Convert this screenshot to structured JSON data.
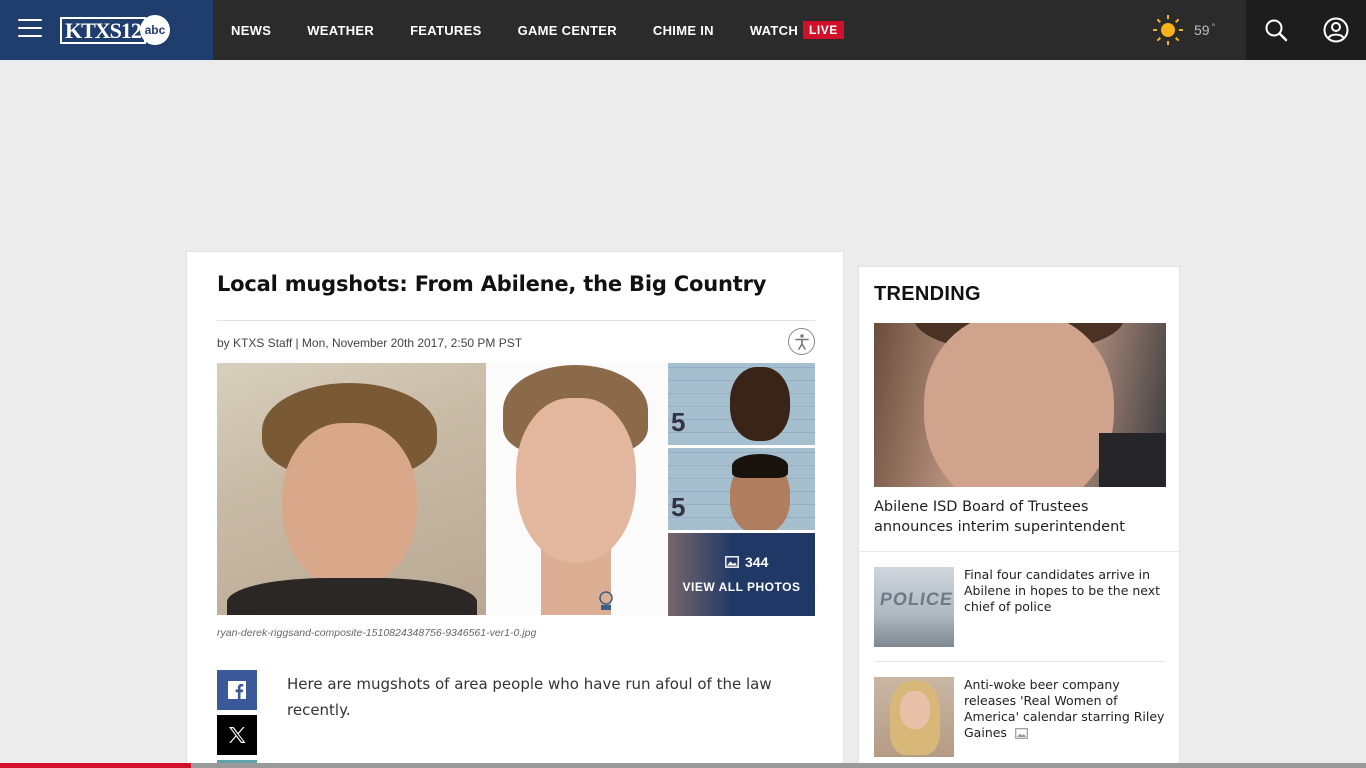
{
  "header": {
    "logo_text": "KTXS12",
    "logo_network": "abc",
    "nav": [
      {
        "label": "NEWS"
      },
      {
        "label": "WEATHER"
      },
      {
        "label": "FEATURES"
      },
      {
        "label": "GAME CENTER"
      },
      {
        "label": "CHIME IN"
      },
      {
        "label": "WATCH"
      }
    ],
    "live_badge": "LIVE",
    "weather": {
      "temp": "59",
      "degree": "°",
      "icon": "sun-icon"
    }
  },
  "article": {
    "headline": "Local mugshots: From Abilene, the Big Country",
    "byline": "by KTXS Staff | Mon, November 20th 2017, 2:50 PM PST",
    "gallery": {
      "photo_count": "344",
      "view_all_label": "VIEW ALL PHOTOS"
    },
    "caption": "ryan-derek-riggsand-composite-1510824348756-9346561-ver1-0.jpg",
    "body": "Here are mugshots of area people who have run afoul of the law recently."
  },
  "trending": {
    "title": "TRENDING",
    "hero_title": "Abilene ISD Board of Trustees announces interim superintendent",
    "items": [
      {
        "title": "Final four candidates arrive in Abilene in hopes to be the next chief of police",
        "thumb_text": "POLICE"
      },
      {
        "title": "Anti-woke beer company releases 'Real Women of America' calendar starring Riley Gaines"
      }
    ]
  },
  "reading_progress": 0.14,
  "colors": {
    "brand_blue": "#1f3e6e",
    "nav_bg": "#2b2b2b",
    "live_red": "#d1102a",
    "facebook": "#3b5998"
  }
}
